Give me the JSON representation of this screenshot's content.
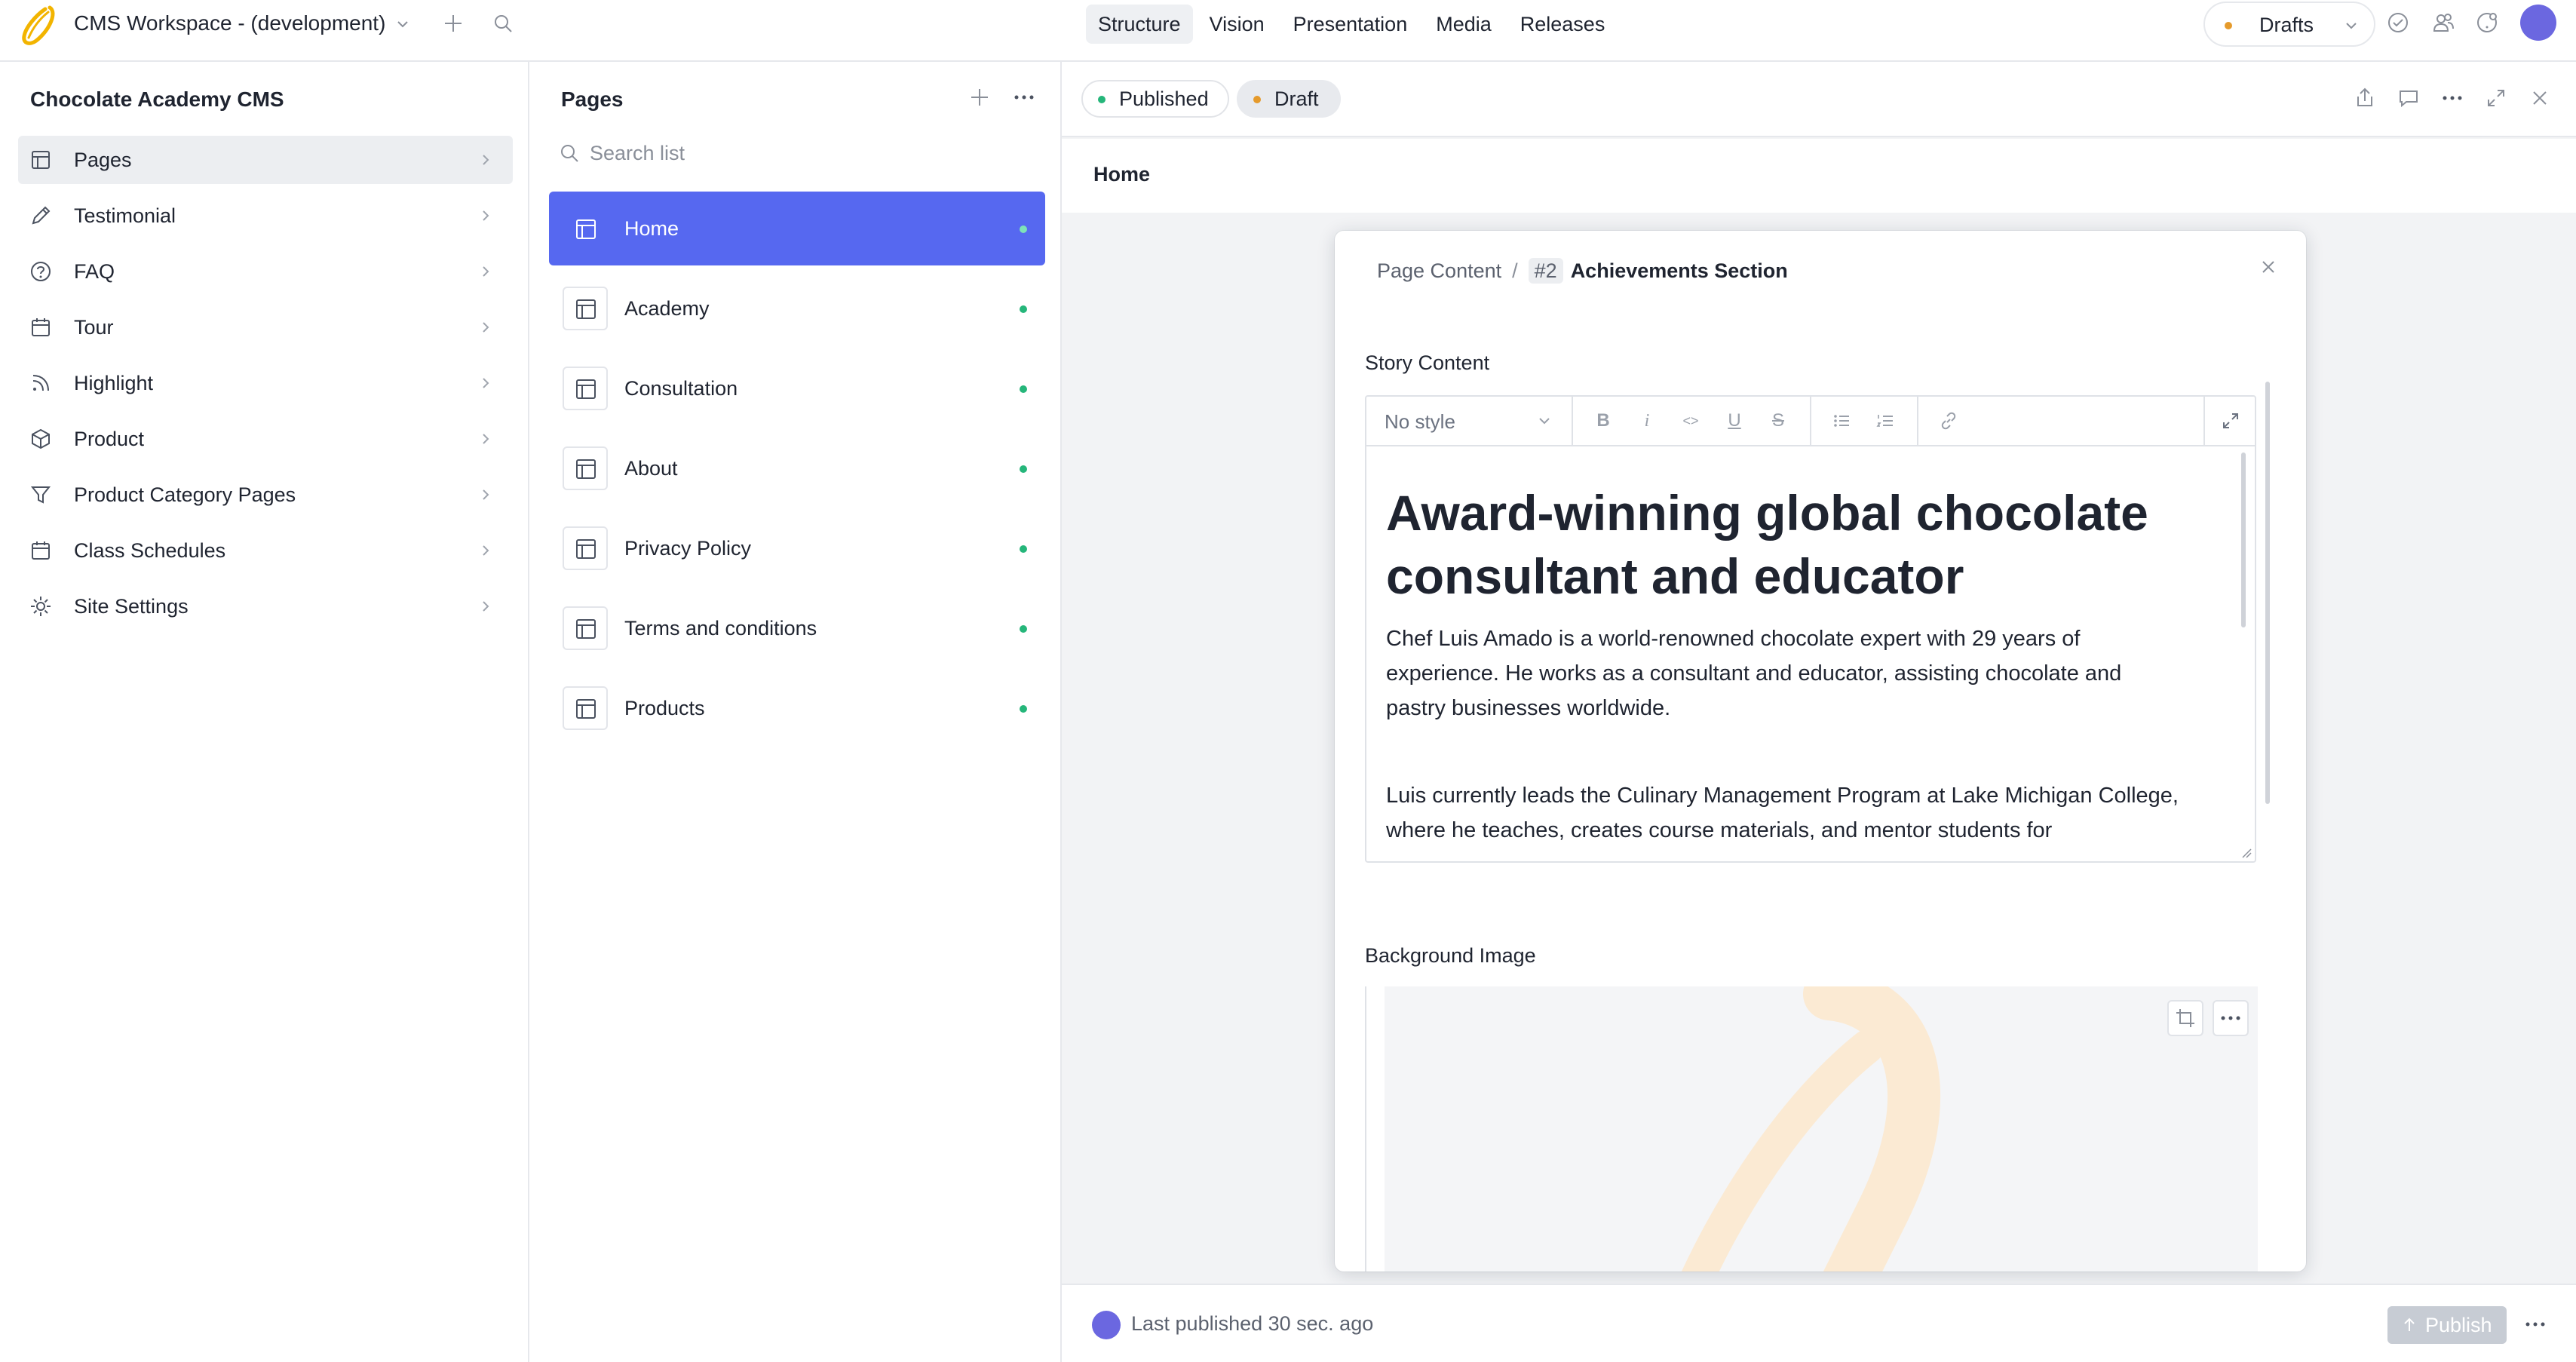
{
  "workspace": {
    "title": "CMS Workspace - (development)"
  },
  "nav": {
    "tabs": [
      "Structure",
      "Vision",
      "Presentation",
      "Media",
      "Releases"
    ],
    "active": "Structure"
  },
  "drafts": {
    "label": "Drafts"
  },
  "sidebar": {
    "title": "Chocolate Academy CMS",
    "items": [
      {
        "label": "Pages",
        "icon": "page-layout-icon"
      },
      {
        "label": "Testimonial",
        "icon": "pencil-icon"
      },
      {
        "label": "FAQ",
        "icon": "help-circle-icon"
      },
      {
        "label": "Tour",
        "icon": "calendar-icon"
      },
      {
        "label": "Highlight",
        "icon": "feed-icon"
      },
      {
        "label": "Product",
        "icon": "package-icon"
      },
      {
        "label": "Product Category Pages",
        "icon": "filter-icon"
      },
      {
        "label": "Class Schedules",
        "icon": "calendar-icon"
      },
      {
        "label": "Site Settings",
        "icon": "gear-icon"
      }
    ]
  },
  "pages": {
    "title": "Pages",
    "search_placeholder": "Search list",
    "items": [
      {
        "label": "Home"
      },
      {
        "label": "Academy"
      },
      {
        "label": "Consultation"
      },
      {
        "label": "About"
      },
      {
        "label": "Privacy Policy"
      },
      {
        "label": "Terms and conditions"
      },
      {
        "label": "Products"
      }
    ]
  },
  "document": {
    "status_published": "Published",
    "status_draft": "Draft",
    "breadcrumb": "Home"
  },
  "modal": {
    "crumb_root": "Page Content",
    "crumb_sep": "/",
    "crumb_index": "#2",
    "crumb_current": "Achievements Section",
    "story_label": "Story Content",
    "style_select": "No style",
    "toolbar": {
      "bold": "B",
      "italic": "i",
      "code": "<>",
      "underline": "U",
      "strike": "S"
    },
    "story_heading": "Award-winning global chocolate consultant and educator",
    "story_p1": "Chef Luis Amado is a world-renowned chocolate expert with 29 years of experience. He works as a consultant and educator, assisting chocolate and pastry businesses worldwide.",
    "story_p2": "Luis currently leads the Culinary Management Program at Lake Michigan College, where he teaches, creates course materials, and mentor students for",
    "background_label": "Background Image"
  },
  "footer": {
    "last_published": "Last published 30 sec. ago",
    "publish_label": "Publish"
  },
  "colors": {
    "selected": "#5668f0",
    "published_dot": "#25b67a",
    "draft_dot": "#e59a2b",
    "avatar": "#6b67e0"
  }
}
